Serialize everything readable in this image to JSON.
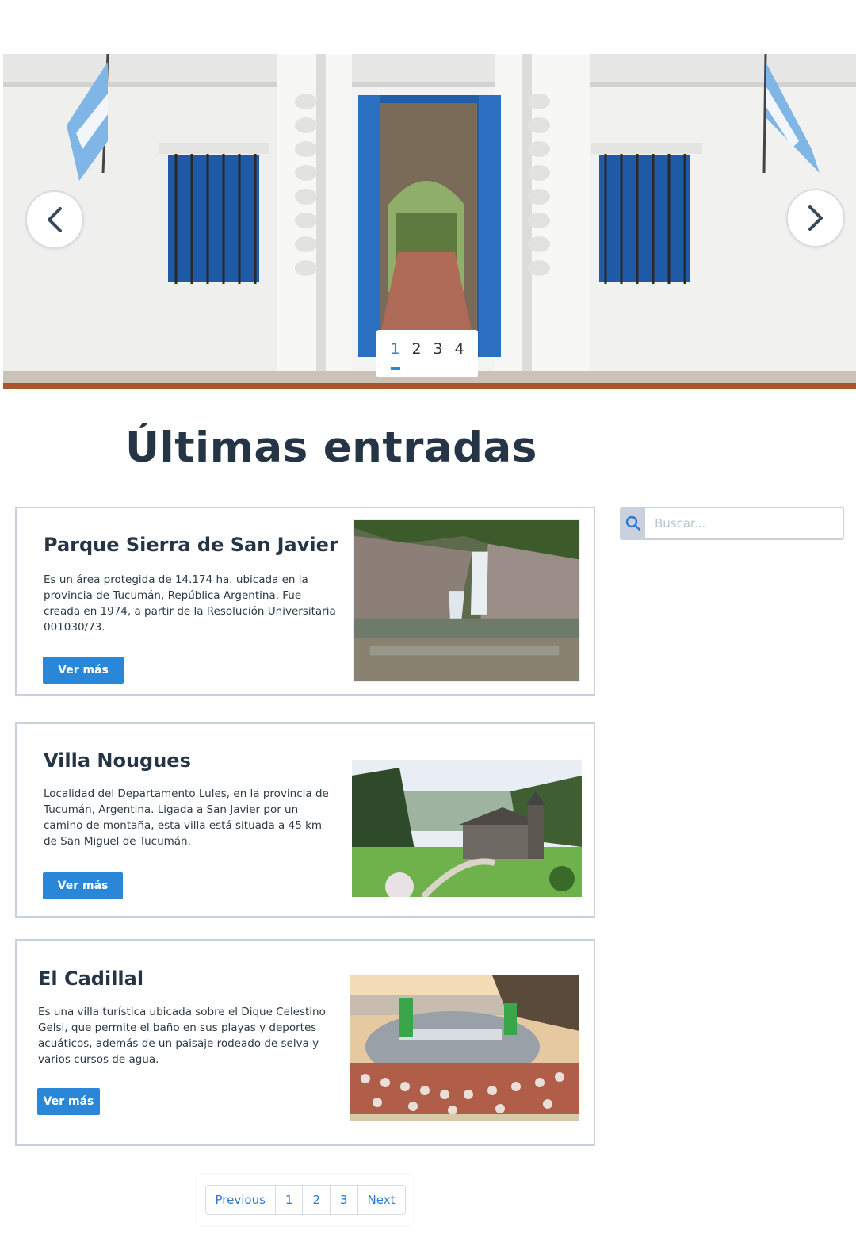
{
  "hero": {
    "prev_icon": "chevron-left-icon",
    "next_icon": "chevron-right-icon",
    "slides": [
      "1",
      "2",
      "3",
      "4"
    ],
    "active_slide": "1",
    "image": "colonial white building with blue doors and Argentine flags"
  },
  "section": {
    "title": "Últimas entradas"
  },
  "posts": [
    {
      "title": "Parque Sierra de San Javier",
      "excerpt": "Es un área protegida de 14.174 ha. ubicada en la provincia de Tucumán, República Argentina. Fue creada en 1974, a partir de la Resolución Universitaria 001030/73.",
      "button": "Ver más",
      "image": "waterfall and rocky pool"
    },
    {
      "title": "Villa Nougues",
      "excerpt": "Localidad del Departamento Lules, en la provincia de Tucumán, Argentina. Ligada a San Javier por un camino de montaña, esta villa está situada a 45 km de San Miguel de Tucumán.",
      "button": "Ver más",
      "image": "stone chapel among gardens"
    },
    {
      "title": "El Cadillal",
      "excerpt": "Es una villa turística ubicada sobre el Dique Celestino Gelsi, que permite el baño en sus playas y deportes acuáticos, además de un paisaje rodeado de selva y varios cursos de agua.",
      "button": "Ver más",
      "image": "amphitheater by the lake at sunset"
    }
  ],
  "search": {
    "placeholder": "Buscar...",
    "value": "",
    "icon": "search-icon"
  },
  "pagination": {
    "previous": "Previous",
    "pages": [
      "1",
      "2",
      "3"
    ],
    "next": "Next"
  },
  "colors": {
    "accent": "#2a87d8",
    "heading": "#263545",
    "border": "#c9d2dc"
  }
}
